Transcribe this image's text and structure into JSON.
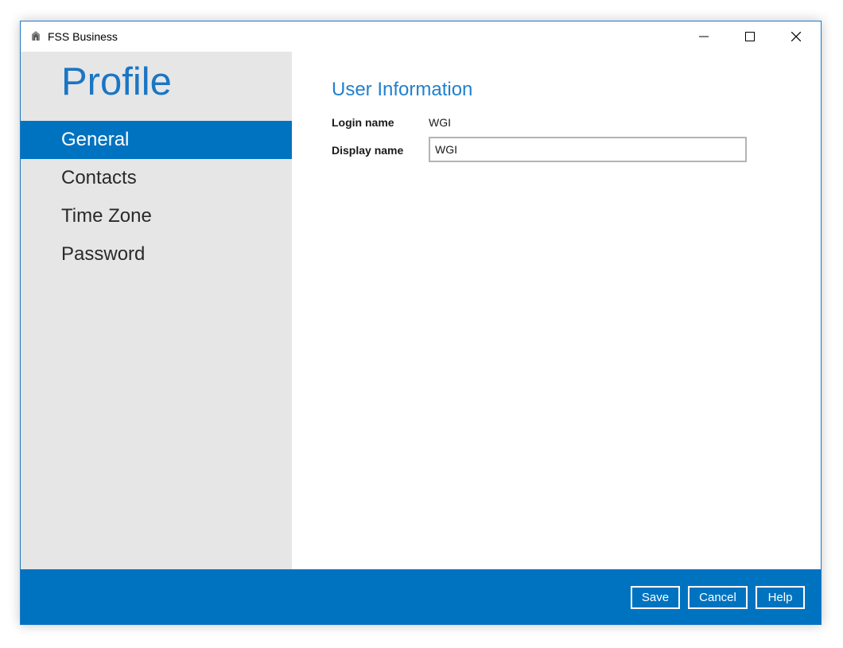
{
  "window": {
    "title": "FSS Business",
    "controls": [
      "minimize-icon",
      "maximize-icon",
      "close-icon"
    ]
  },
  "sidebar": {
    "title": "Profile",
    "items": [
      {
        "label": "General",
        "active": true
      },
      {
        "label": "Contacts",
        "active": false
      },
      {
        "label": "Time Zone",
        "active": false
      },
      {
        "label": "Password",
        "active": false
      }
    ]
  },
  "content": {
    "section_title": "User Information",
    "login_name_label": "Login name",
    "login_name_value": "WGI",
    "display_name_label": "Display name",
    "display_name_value": "WGI"
  },
  "footer": {
    "save_label": "Save",
    "cancel_label": "Cancel",
    "help_label": "Help"
  },
  "colors": {
    "accent": "#0073c0",
    "title_blue": "#1a76c4",
    "sidebar_bg": "#e6e6e6"
  }
}
